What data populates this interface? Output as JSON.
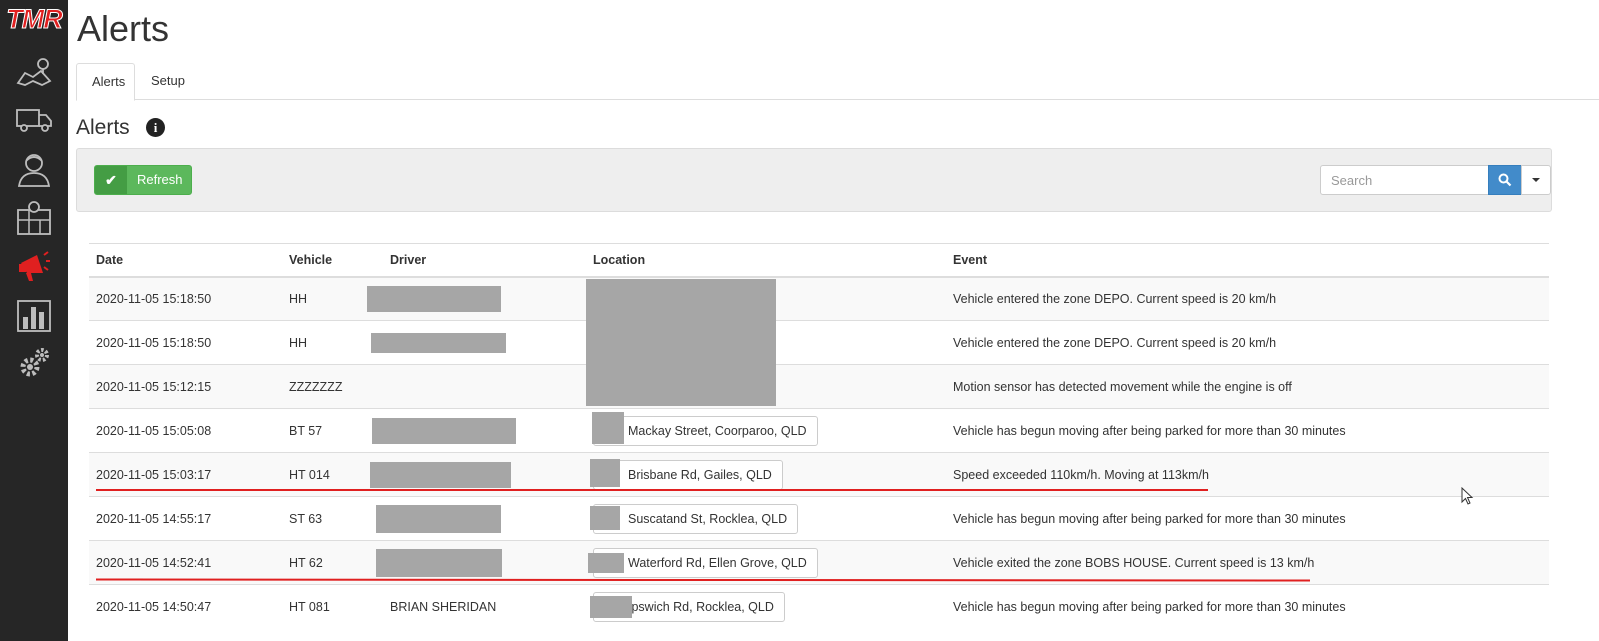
{
  "app": {
    "logo_text": "TMR",
    "accent_color": "#e02020"
  },
  "sidebar": {
    "items": [
      {
        "icon": "map-icon",
        "active": false
      },
      {
        "icon": "truck-icon",
        "active": false
      },
      {
        "icon": "driver-icon",
        "active": false
      },
      {
        "icon": "zone-map-icon",
        "active": false
      },
      {
        "icon": "megaphone-icon",
        "active": true
      },
      {
        "icon": "reports-chart-icon",
        "active": false
      },
      {
        "icon": "settings-gears-icon",
        "active": false
      }
    ]
  },
  "page": {
    "title": "Alerts",
    "tabs": [
      {
        "label": "Alerts",
        "active": true
      },
      {
        "label": "Setup",
        "active": false
      }
    ],
    "section_title": "Alerts",
    "info_icon": "i"
  },
  "toolbar": {
    "refresh_label": "Refresh",
    "search_placeholder": "Search"
  },
  "table": {
    "headers": [
      "Date",
      "Vehicle",
      "Driver",
      "Location",
      "Event"
    ],
    "rows": [
      {
        "date": "2020-11-05 15:18:50",
        "vehicle": "HH",
        "driver": "",
        "location": "",
        "event": "Vehicle entered the zone DEPO. Current speed is 20 km/h"
      },
      {
        "date": "2020-11-05 15:18:50",
        "vehicle": "HH",
        "driver": "",
        "location": "",
        "event": "Vehicle entered the zone DEPO. Current speed is 20 km/h"
      },
      {
        "date": "2020-11-05 15:12:15",
        "vehicle": "ZZZZZZZ",
        "driver": "",
        "location": "",
        "event": "Motion sensor has detected movement while the engine is off"
      },
      {
        "date": "2020-11-05 15:05:08",
        "vehicle": "BT 57",
        "driver": "",
        "location": "Mackay Street, Coorparoo, QLD",
        "event": "Vehicle has begun moving after being parked for more than 30 minutes"
      },
      {
        "date": "2020-11-05 15:03:17",
        "vehicle": "HT 014",
        "driver": "",
        "location": "Brisbane Rd, Gailes, QLD",
        "event": "Speed exceeded 110km/h. Moving at 113km/h"
      },
      {
        "date": "2020-11-05 14:55:17",
        "vehicle": "ST 63",
        "driver": "",
        "location": "Suscatand St, Rocklea, QLD",
        "event": "Vehicle has begun moving after being parked for more than 30 minutes"
      },
      {
        "date": "2020-11-05 14:52:41",
        "vehicle": "HT 62",
        "driver": "",
        "location": "Waterford Rd, Ellen Grove, QLD",
        "event": "Vehicle exited the zone BOBS HOUSE. Current speed is 13 km/h"
      },
      {
        "date": "2020-11-05 14:50:47",
        "vehicle": "HT 081",
        "driver": "BRIAN SHERIDAN",
        "location": "Ipswich Rd, Rocklea, QLD",
        "event": "Vehicle has begun moving after being parked for more than 30 minutes"
      }
    ]
  }
}
